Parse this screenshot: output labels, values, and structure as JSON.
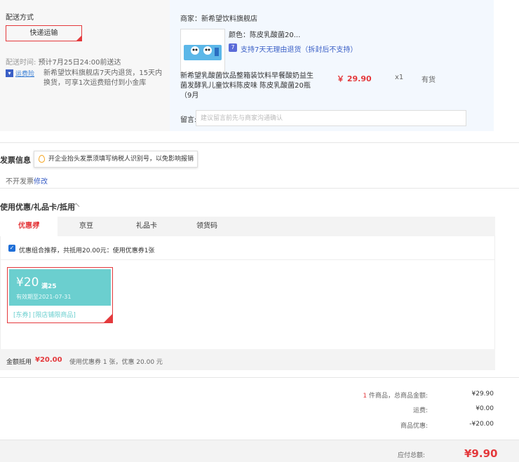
{
  "shipping": {
    "title": "配送方式",
    "method": "快递运输",
    "time_label": "配送时间:",
    "time_value": "预计7月25日24:00前送达",
    "insurance_label": "运费险",
    "insurance_desc": "新希望饮料旗舰店7天内退货，15天内换货，可享1次运费赔付到小金库"
  },
  "goods": {
    "merchant": "商家：新希望饮料旗舰店",
    "color": "颜色：陈皮乳酸菌20...",
    "return_policy": "支持7天无理由退货（拆封后不支持）",
    "name": "新希望乳酸菌饮品整箱装饮料早餐酸奶益生菌发酵乳儿童饮料陈皮味 陈皮乳酸菌20瓶（9月",
    "price": "￥ 29.90",
    "qty": "x1",
    "stock": "有货",
    "note_label": "留言:",
    "note_placeholder": "建议留言前先与商家沟通确认"
  },
  "invoice": {
    "title": "发票信息",
    "tip": "开企业抬头发票须填写纳税人识别号，以免影响报销",
    "state": "不开发票",
    "edit": "修改"
  },
  "coupon": {
    "title": "使用优惠/礼品卡/抵用",
    "tabs": [
      "优惠券",
      "京豆",
      "礼品卡",
      "领货码"
    ],
    "combo_text": "优惠组合推荐，共抵用20.00元：使用优惠券1张",
    "card": {
      "amount": "¥20",
      "condition": "满25",
      "expiry": "有效期至2021-07-31",
      "tag": "[东券] [限店铺限商品]"
    },
    "sum_label": "金额抵用",
    "sum_amount": "¥20.00",
    "sum_desc": "使用优惠券 1 张，优惠 20.00 元"
  },
  "totals": {
    "count": "1",
    "count_label": " 件商品，总商品金额:",
    "goods_total": "¥29.90",
    "shipping_label": "运费:",
    "shipping": "¥0.00",
    "discount_label": "商品优惠:",
    "discount": "-¥20.00",
    "final_label": "应付总额:",
    "final": "¥9.90"
  },
  "colors": {
    "accent": "#e4393c",
    "coupon": "#6bcfcf",
    "link": "#3a5fc6"
  }
}
